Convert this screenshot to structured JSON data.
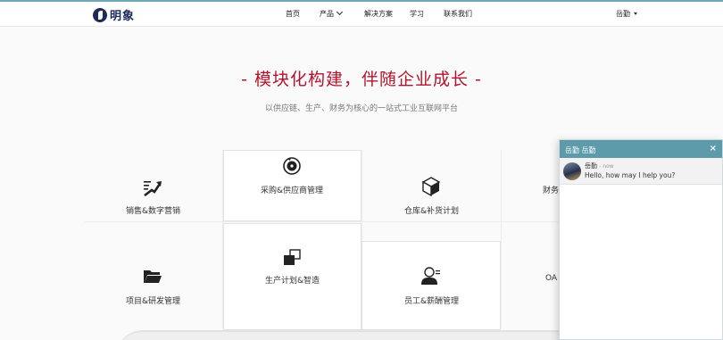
{
  "brand": {
    "name": "明象"
  },
  "nav": {
    "home": "首页",
    "products": "产品",
    "solutions": "解决方案",
    "learn": "学习",
    "contact": "联系我们",
    "user": "岳勤"
  },
  "hero": {
    "title": "- 模块化构建，伴随企业成长 -",
    "subtitle": "以供应链、生产、财务为核心的一站式工业互联网平台"
  },
  "modules": {
    "sales": "销售&数字营销",
    "purchase": "采购&供应商管理",
    "warehouse": "仓库&补货计划",
    "finance": "财务",
    "project": "项目&研发管理",
    "production": "生产计划&智造",
    "hr": "员工&薪酬管理",
    "oa": "OA"
  },
  "chat": {
    "title": "岳勤 岳勤",
    "close": "×",
    "message": {
      "sender": "岳勤",
      "time": "- now",
      "text": "Hello, how may I help you?"
    }
  },
  "colors": {
    "accent": "#b3142d",
    "chat_header": "#5d9aaa",
    "brand": "#1d2a5c"
  }
}
